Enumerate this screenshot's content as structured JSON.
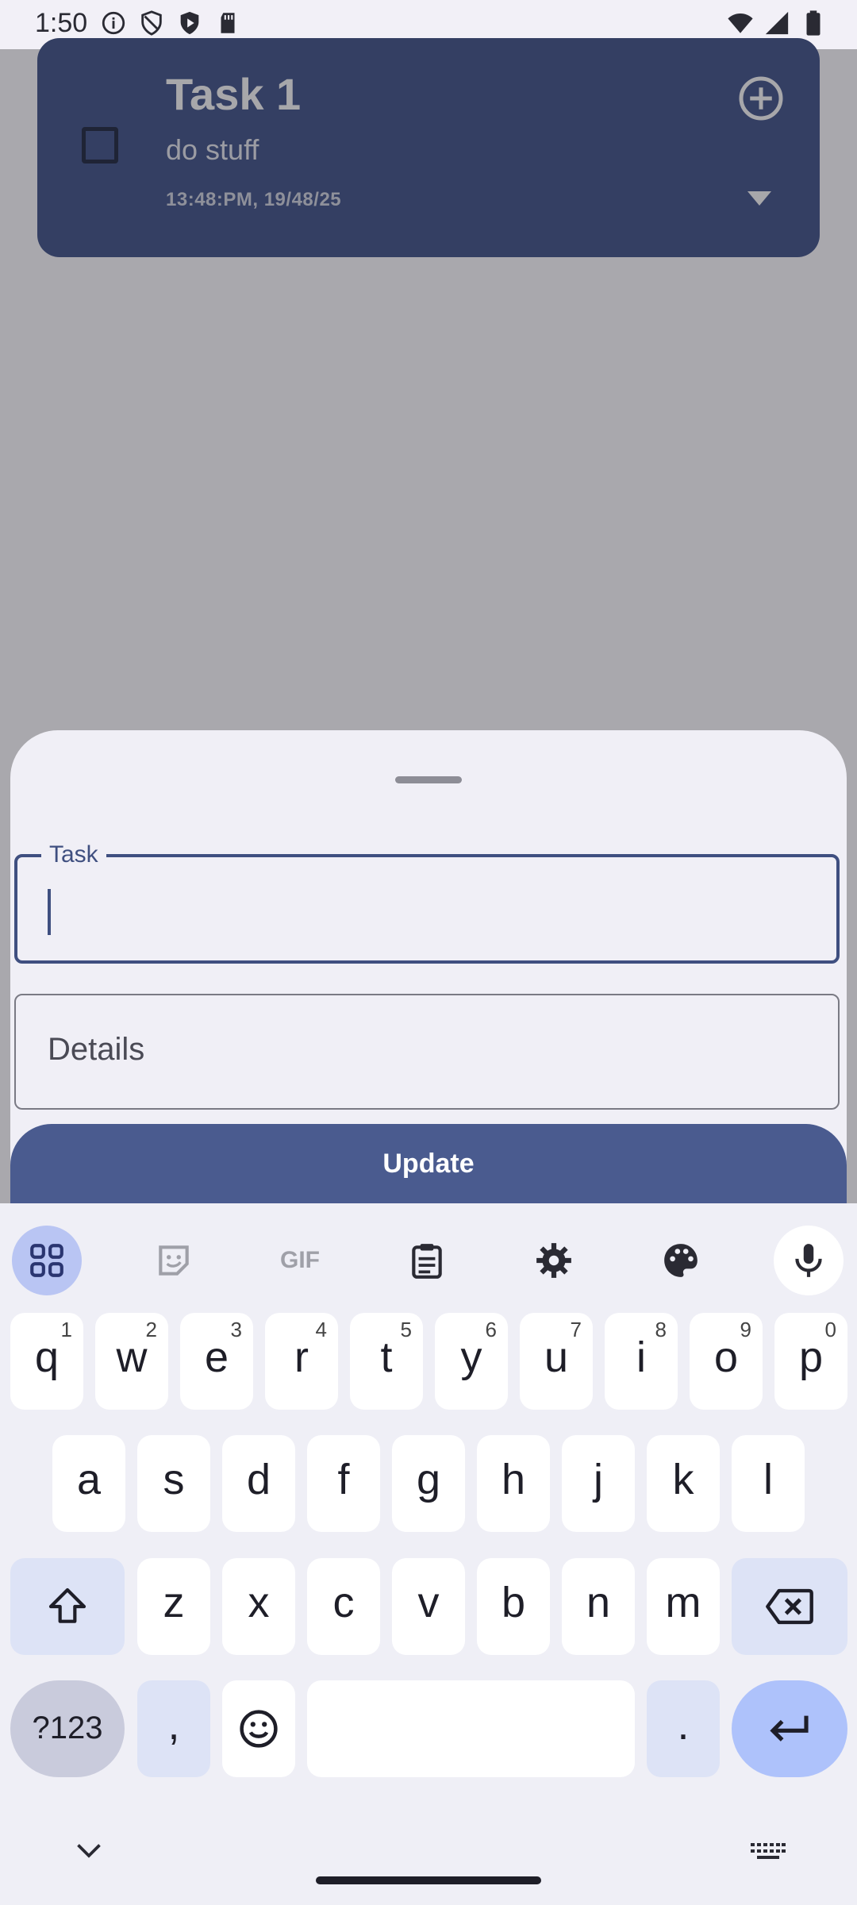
{
  "status_bar": {
    "time": "1:50",
    "left_icons": [
      "info-icon",
      "shield-icon",
      "play-protect-icon",
      "sd-card-icon"
    ],
    "right_icons": [
      "wifi-icon",
      "signal-icon",
      "battery-icon"
    ]
  },
  "task_card": {
    "title": "Task 1",
    "detail": "do stuff",
    "timestamp": "13:48:PM, 19/48/25",
    "checked": false
  },
  "sheet": {
    "task_label": "Task",
    "task_value": "",
    "details_placeholder": "Details",
    "update_label": "Update"
  },
  "keyboard": {
    "toolbar": [
      "apps-grid-icon",
      "sticker-icon",
      "GIF",
      "clipboard-icon",
      "settings-icon",
      "palette-icon",
      "microphone-icon"
    ],
    "gif_label": "GIF",
    "row1": [
      {
        "ch": "q",
        "num": "1"
      },
      {
        "ch": "w",
        "num": "2"
      },
      {
        "ch": "e",
        "num": "3"
      },
      {
        "ch": "r",
        "num": "4"
      },
      {
        "ch": "t",
        "num": "5"
      },
      {
        "ch": "y",
        "num": "6"
      },
      {
        "ch": "u",
        "num": "7"
      },
      {
        "ch": "i",
        "num": "8"
      },
      {
        "ch": "o",
        "num": "9"
      },
      {
        "ch": "p",
        "num": "0"
      }
    ],
    "row2": [
      "a",
      "s",
      "d",
      "f",
      "g",
      "h",
      "j",
      "k",
      "l"
    ],
    "row3": [
      "z",
      "x",
      "c",
      "v",
      "b",
      "n",
      "m"
    ],
    "symbols_label": "?123",
    "comma": ",",
    "period": "."
  },
  "colors": {
    "accent": "#3f4f80",
    "card": "#343f63",
    "button": "#4a5b8f",
    "scrim": "#a9a8ad"
  }
}
